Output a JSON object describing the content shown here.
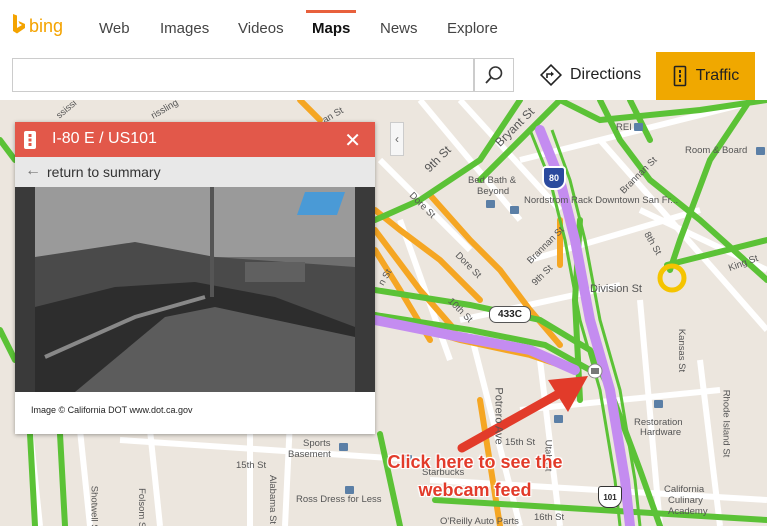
{
  "brand": {
    "logo_text": "bing"
  },
  "nav": {
    "tabs": [
      {
        "label": "Web"
      },
      {
        "label": "Images"
      },
      {
        "label": "Videos"
      },
      {
        "label": "Maps"
      },
      {
        "label": "News"
      },
      {
        "label": "Explore"
      }
    ],
    "active": "Maps"
  },
  "search": {
    "value": "",
    "placeholder": ""
  },
  "actions": {
    "directions_label": "Directions",
    "traffic_label": "Traffic"
  },
  "colors": {
    "brand": "#f4a300",
    "traffic_button": "#f0a800",
    "panel_header": "#e2584a",
    "annotation": "#e23b2a",
    "road_heavy": "#5bc236",
    "road_medium": "#f5a623",
    "road_highway": "#c48cf0"
  },
  "panel": {
    "title": "I-80 E / US101",
    "back_label": "return to summary",
    "credit": "Image © California DOT www.dot.ca.gov",
    "icon": "traffic-light-icon"
  },
  "map": {
    "labels": {
      "st_9th": "9th St",
      "bryant": "Bryant St",
      "rei": "REI",
      "room_board": "Room & Board",
      "brannan": "Brannan St",
      "bed_bath_1": "Bed Bath &",
      "bed_bath_2": "Beyond",
      "nordstrom": "Nordstrom Rack Downtown San Fr...",
      "dore": "Dore St",
      "dore2": "Dore St",
      "st_8th": "8th St",
      "division": "Division St",
      "king": "King St",
      "brannan2": "Brannan St",
      "st_9th_b": "9th St",
      "st_10th": "10th St",
      "kansas": "Kansas St",
      "rhode": "Rhode Island St",
      "potrero": "Potrero Ave",
      "st_15th": "15th St",
      "starbucks": "Starbucks",
      "sports1": "Sports",
      "sports2": "Basement",
      "st_15th_b": "15th St",
      "alabama": "Alabama St",
      "ross": "Ross Dress for Less",
      "shotwell": "Shotwell St",
      "folsom": "Folsom St",
      "restoration1": "Restoration",
      "restoration2": "Hardware",
      "cca1": "California",
      "cca2": "Culinary",
      "cca3": "Academy",
      "st_16th": "16th St",
      "auto": "O'Reilly Auto Parts",
      "utah": "Utah St",
      "ssissi": "ssissi",
      "rissling": "rissling",
      "an_st": "an St",
      "n_st": "n St"
    },
    "shields": {
      "i80": "80",
      "ca433c": "433C",
      "us101": "101"
    }
  },
  "annotation": {
    "line1": "Click here to see the",
    "line2": "webcam feed"
  }
}
